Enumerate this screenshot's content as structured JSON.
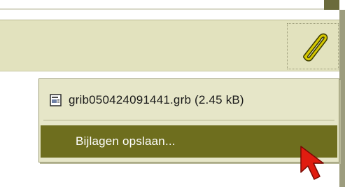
{
  "toolbar": {
    "attachment_button_icon": "paperclip-icon"
  },
  "attachment_menu": {
    "file_icon": "document-icon",
    "file_label": "grib050424091441.grb (2.45 kB)",
    "save_label": "Bijlagen opslaan..."
  },
  "colors": {
    "toolbar_bg": "#e2e2be",
    "menu_bg": "#e6e6c8",
    "highlight": "#6e6e1e",
    "paperclip": "#d6c800",
    "cursor": "#e01c10"
  }
}
